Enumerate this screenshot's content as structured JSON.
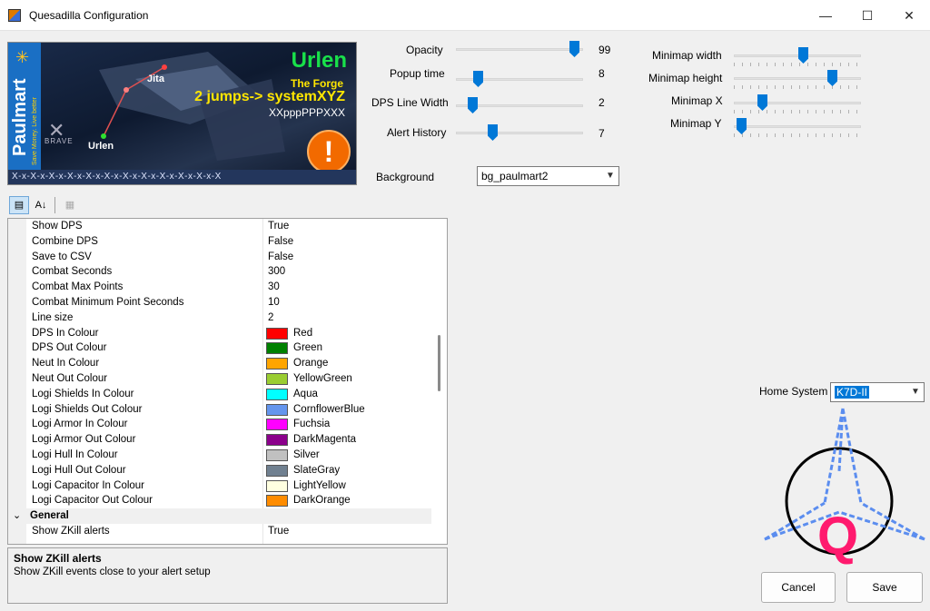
{
  "window": {
    "title": "Quesadilla Configuration",
    "minimize_glyph": "—",
    "maximize_glyph": "☐",
    "close_glyph": "✕"
  },
  "banner": {
    "brand": "Paulmart",
    "tagline": "Save Money. Live better",
    "system_name": "Urlen",
    "region": "The Forge",
    "jumps_text": "2 jumps-> systemXYZ",
    "route_code": "XXpppPPPXXX",
    "map_label_jita": "Jita",
    "map_label_urlen": "Urlen",
    "alliance": "BRAVE",
    "alert_glyph": "!",
    "footer_pattern": "X-x-X-x-X-x-X-x-X-x-X-x-X-x-X-x-X-x-X-x-X-x-X"
  },
  "sliders": {
    "opacity": {
      "label": "Opacity",
      "value": "99",
      "fraction": 0.97
    },
    "popup_time": {
      "label": "Popup time",
      "value": "8",
      "fraction": 0.15
    },
    "dps_line_width": {
      "label": "DPS Line Width",
      "value": "2",
      "fraction": 0.1
    },
    "alert_history": {
      "label": "Alert History",
      "value": "7",
      "fraction": 0.27
    },
    "minimap_width": {
      "label": "Minimap width",
      "fraction": 0.55
    },
    "minimap_height": {
      "label": "Minimap height",
      "fraction": 0.8
    },
    "minimap_x": {
      "label": "Minimap X",
      "fraction": 0.2
    },
    "minimap_y": {
      "label": "Minimap Y",
      "fraction": 0.02
    }
  },
  "background": {
    "label": "Background",
    "value": "bg_paulmart2"
  },
  "home_system": {
    "label": "Home System",
    "value": "K7D-II"
  },
  "toolbar": {
    "categorized_icon": "categorized-icon",
    "alphabetical_icon": "alphabetical-icon",
    "pages_icon": "property-pages-icon",
    "alpha_glyph": "A↓",
    "cat_glyph": "▤",
    "pages_glyph": "▦"
  },
  "grid": {
    "rows": [
      {
        "name": "Show DPS",
        "value": "True"
      },
      {
        "name": "Combine DPS",
        "value": "False"
      },
      {
        "name": "Save to CSV",
        "value": "False"
      },
      {
        "name": "Combat Seconds",
        "value": "300"
      },
      {
        "name": "Combat Max Points",
        "value": "30"
      },
      {
        "name": "Combat Minimum Point Seconds",
        "value": "10"
      },
      {
        "name": "Line size",
        "value": "2"
      },
      {
        "name": "DPS In Colour",
        "value": "Red",
        "color": "#ff0000"
      },
      {
        "name": "DPS Out Colour",
        "value": "Green",
        "color": "#008000"
      },
      {
        "name": "Neut In Colour",
        "value": "Orange",
        "color": "#ffa500"
      },
      {
        "name": "Neut Out Colour",
        "value": "YellowGreen",
        "color": "#9acd32"
      },
      {
        "name": "Logi Shields In Colour",
        "value": "Aqua",
        "color": "#00ffff"
      },
      {
        "name": "Logi Shields Out Colour",
        "value": "CornflowerBlue",
        "color": "#6495ed"
      },
      {
        "name": "Logi Armor In Colour",
        "value": "Fuchsia",
        "color": "#ff00ff"
      },
      {
        "name": "Logi Armor Out Colour",
        "value": "DarkMagenta",
        "color": "#8b008b"
      },
      {
        "name": "Logi Hull In Colour",
        "value": "Silver",
        "color": "#c0c0c0"
      },
      {
        "name": "Logi Hull Out Colour",
        "value": "SlateGray",
        "color": "#708090"
      },
      {
        "name": "Logi Capacitor In Colour",
        "value": "LightYellow",
        "color": "#ffffe0"
      },
      {
        "name": "Logi Capacitor Out Colour",
        "value": "DarkOrange",
        "color": "#ff8c00"
      }
    ],
    "category": "General",
    "after_rows": [
      {
        "name": "Show ZKill alerts",
        "value": "True"
      },
      {
        "name": "",
        "value": ""
      }
    ]
  },
  "help": {
    "title": "Show ZKill alerts",
    "description": "Show ZKill events close to your alert setup"
  },
  "buttons": {
    "cancel": "Cancel",
    "save": "Save"
  },
  "colors": {
    "accent": "#0078d7",
    "logo_pink": "#ff1a6e",
    "logo_blue": "#5b8def"
  }
}
